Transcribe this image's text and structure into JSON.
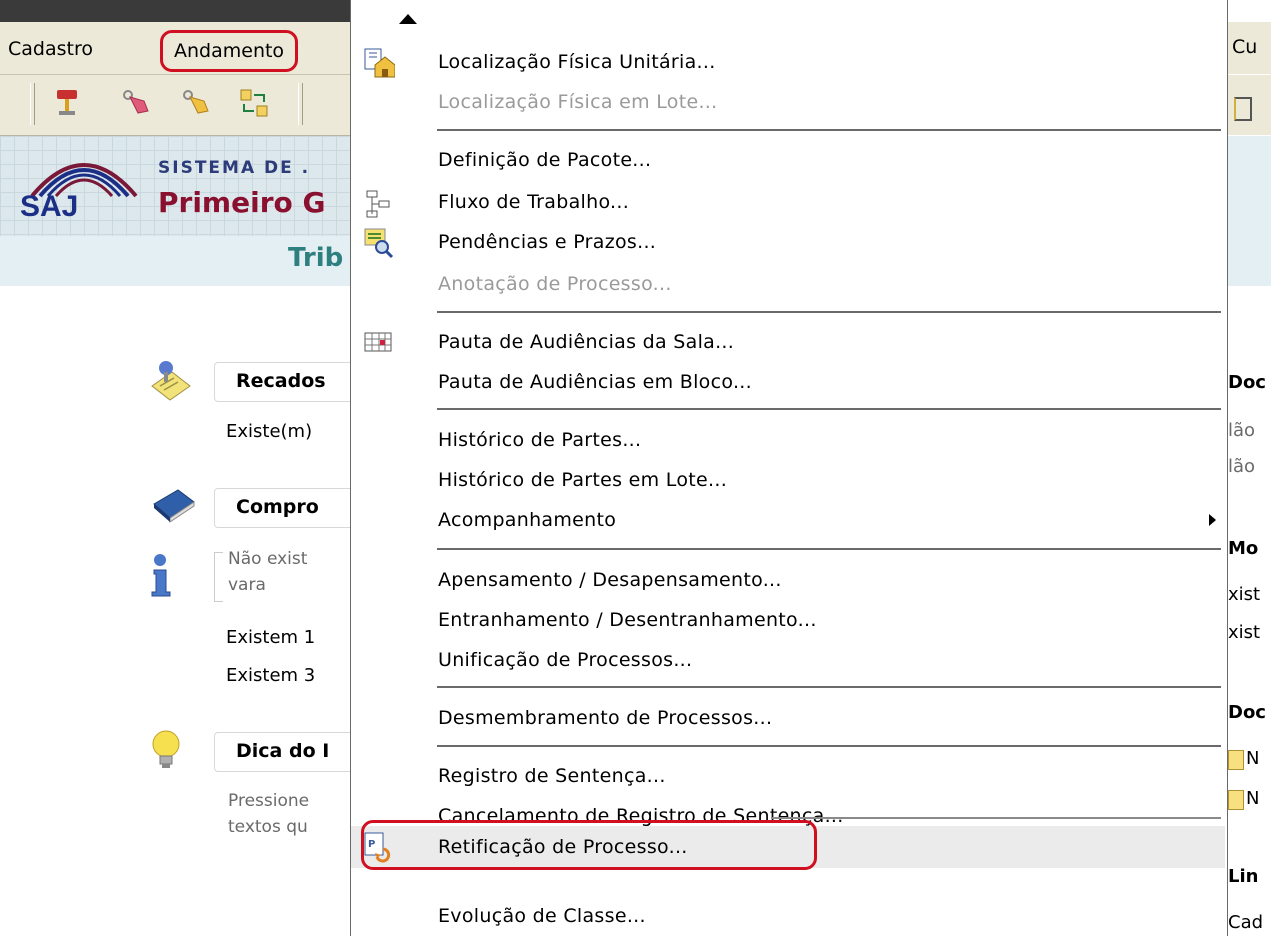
{
  "menubar": {
    "items": [
      {
        "label": "Cadastro"
      },
      {
        "label": "Andamento"
      }
    ],
    "right_partial": "Cu"
  },
  "banner": {
    "logo_text": "SAJ",
    "subtitle": "SISTEMA DE .",
    "title": "Primeiro G",
    "subbanner": "Trib"
  },
  "left_sections": {
    "recados": {
      "title": "Recados",
      "text": "Existe(m)"
    },
    "compromissos": {
      "title": "Compro",
      "line1": "Não exist",
      "line2": "vara",
      "line3": "Existem 1",
      "line4": "Existem 3"
    },
    "dica": {
      "title": "Dica do I",
      "line1": "Pressione",
      "line2": "textos qu"
    }
  },
  "right_partial": {
    "doc1": "Doc",
    "nao1": "lão",
    "nao2": "lão",
    "mo": "Mo",
    "xist1": "xist",
    "xist2": "xist",
    "doc2": "Doc",
    "m1": "N",
    "m2": "N",
    "lin": "Lin",
    "cad": "Cad"
  },
  "dropdown": {
    "items": [
      {
        "label": "Localização Física Unitária...",
        "icon": "building-file-icon",
        "enabled": true
      },
      {
        "label": "Localização Física em Lote...",
        "icon": "",
        "enabled": false
      },
      {
        "label": "Definição de Pacote...",
        "icon": "",
        "enabled": true
      },
      {
        "label": "Fluxo de Trabalho...",
        "icon": "workflow-icon",
        "enabled": true
      },
      {
        "label": "Pendências e Prazos...",
        "icon": "search-document-icon",
        "enabled": true
      },
      {
        "label": "Anotação de Processo...",
        "icon": "",
        "enabled": false
      },
      {
        "label": "Pauta de Audiências da Sala...",
        "icon": "calendar-grid-icon",
        "enabled": true
      },
      {
        "label": "Pauta de Audiências em Bloco...",
        "icon": "",
        "enabled": true
      },
      {
        "label": "Histórico de Partes...",
        "icon": "",
        "enabled": true
      },
      {
        "label": "Histórico de Partes em Lote...",
        "icon": "",
        "enabled": true
      },
      {
        "label": "Acompanhamento",
        "icon": "",
        "enabled": true,
        "submenu": true
      },
      {
        "label": "Apensamento / Desapensamento...",
        "icon": "",
        "enabled": true
      },
      {
        "label": "Entranhamento / Desentranhamento...",
        "icon": "",
        "enabled": true
      },
      {
        "label": "Unificação de Processos...",
        "icon": "",
        "enabled": true
      },
      {
        "label": "Desmembramento de Processos...",
        "icon": "",
        "enabled": true
      },
      {
        "label": "Registro de Sentença...",
        "icon": "",
        "enabled": true
      },
      {
        "label": "Cancelamento de Registro de Sentença...",
        "icon": "",
        "enabled": true
      },
      {
        "label": "Retificação de Processo...",
        "icon": "process-refresh-icon",
        "enabled": true,
        "highlighted": true
      },
      {
        "label": "Evolução de Classe...",
        "icon": "",
        "enabled": true
      }
    ]
  },
  "colors": {
    "annotation_red": "#d01020",
    "menubar_bg": "#ece9d8",
    "banner_title": "#8a1030",
    "subbanner_text": "#2e7f7f"
  }
}
